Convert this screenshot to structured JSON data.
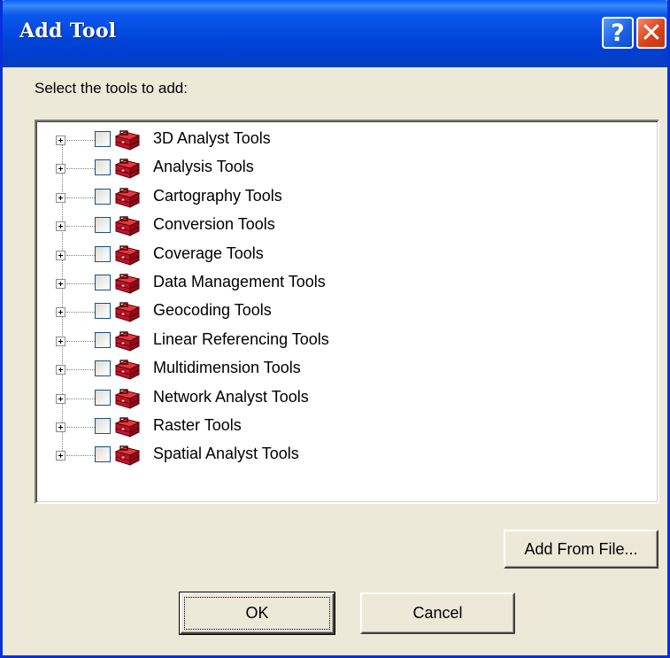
{
  "window": {
    "title": "Add Tool",
    "help_label": "?",
    "close_label": "✕"
  },
  "instruction": "Select the tools to add:",
  "tree": {
    "items": [
      {
        "label": "3D Analyst Tools",
        "checked": false
      },
      {
        "label": "Analysis Tools",
        "checked": false
      },
      {
        "label": "Cartography Tools",
        "checked": false
      },
      {
        "label": "Conversion Tools",
        "checked": false
      },
      {
        "label": "Coverage Tools",
        "checked": false
      },
      {
        "label": "Data Management Tools",
        "checked": false
      },
      {
        "label": "Geocoding Tools",
        "checked": false
      },
      {
        "label": "Linear Referencing Tools",
        "checked": false
      },
      {
        "label": "Multidimension Tools",
        "checked": false
      },
      {
        "label": "Network Analyst Tools",
        "checked": false
      },
      {
        "label": "Raster Tools",
        "checked": false
      },
      {
        "label": "Spatial Analyst Tools",
        "checked": false
      }
    ],
    "item_icon": "toolbox-icon",
    "expander_icon": "plus-expander-icon"
  },
  "buttons": {
    "add_from_file": "Add From File...",
    "ok": "OK",
    "cancel": "Cancel"
  },
  "colors": {
    "titlebar": "#0054e3",
    "close_button": "#d9421c",
    "toolbox_red": "#c8102e",
    "face": "#ece9d8"
  }
}
